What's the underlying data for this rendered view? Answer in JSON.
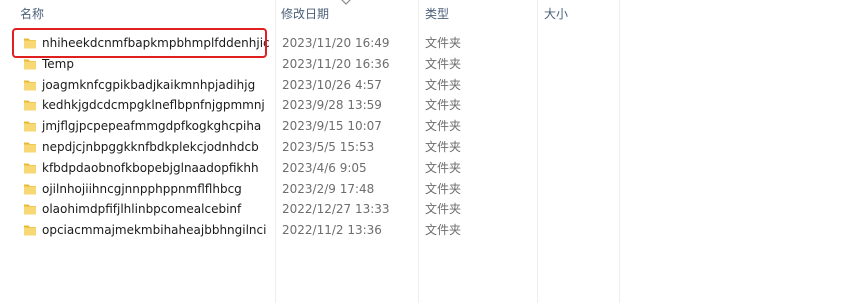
{
  "header": {
    "name_label": "名称",
    "date_label": "修改日期",
    "type_label": "类型",
    "size_label": "大小"
  },
  "rows": [
    {
      "name": "nhiheekdcnmfbapkmpbhmplfddenhjic",
      "date": "2023/11/20 16:49",
      "type": "文件夹",
      "size": ""
    },
    {
      "name": "Temp",
      "date": "2023/11/20 16:36",
      "type": "文件夹",
      "size": ""
    },
    {
      "name": "joagmknfcgpikbadjkaikmnhpjadihjg",
      "date": "2023/10/26 4:57",
      "type": "文件夹",
      "size": ""
    },
    {
      "name": "kedhkjgdcdcmpgklneflbpnfnjgpmmnj",
      "date": "2023/9/28 13:59",
      "type": "文件夹",
      "size": ""
    },
    {
      "name": "jmjflgjpcpepeafmmgdpfkogkghcpiha",
      "date": "2023/9/15 10:07",
      "type": "文件夹",
      "size": ""
    },
    {
      "name": "nepdjcjnbpggkknfbdkplekcjodnhdcb",
      "date": "2023/5/5 15:53",
      "type": "文件夹",
      "size": ""
    },
    {
      "name": "kfbdpdaobnofkbopebjglnaadopfikhh",
      "date": "2023/4/6 9:05",
      "type": "文件夹",
      "size": ""
    },
    {
      "name": "ojilnhojiihncgjnnpphppnmflflhbcg",
      "date": "2023/2/9 17:48",
      "type": "文件夹",
      "size": ""
    },
    {
      "name": "olaohimdpfifjlhlinbpcomealcebinf",
      "date": "2022/12/27 13:33",
      "type": "文件夹",
      "size": ""
    },
    {
      "name": "opciacmmajmekmbihaheajbbhngilnci",
      "date": "2022/11/2 13:36",
      "type": "文件夹",
      "size": ""
    }
  ],
  "icons": {
    "folder": "folder-icon",
    "sort": "chevron-down-icon"
  },
  "colors": {
    "folder_fill": "#f8d775",
    "folder_tab": "#e8b931",
    "highlight": "#e02020"
  }
}
